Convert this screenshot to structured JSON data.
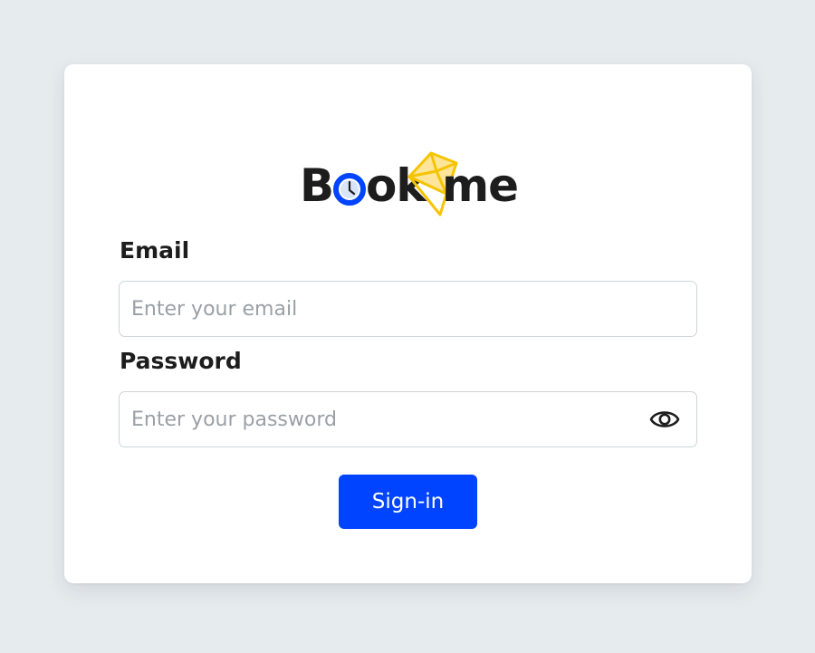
{
  "logo": {
    "text_b": "B",
    "text_ok": "ok",
    "text_me": "me",
    "brand_color": "#0044ff",
    "accent_color": "#f5c400",
    "icons": [
      "clock-icon",
      "envelope-icon"
    ]
  },
  "form": {
    "email_label": "Email",
    "email_placeholder": "Enter your email",
    "email_value": "",
    "password_label": "Password",
    "password_placeholder": "Enter your password",
    "password_value": "",
    "password_toggle_icon": "eye-icon",
    "submit_label": "Sign-in"
  },
  "colors": {
    "page_background": "#e6ebee",
    "card_background": "#ffffff",
    "primary_button": "#0044ff",
    "text": "#1d1d1d",
    "placeholder": "#9aa0a6"
  }
}
